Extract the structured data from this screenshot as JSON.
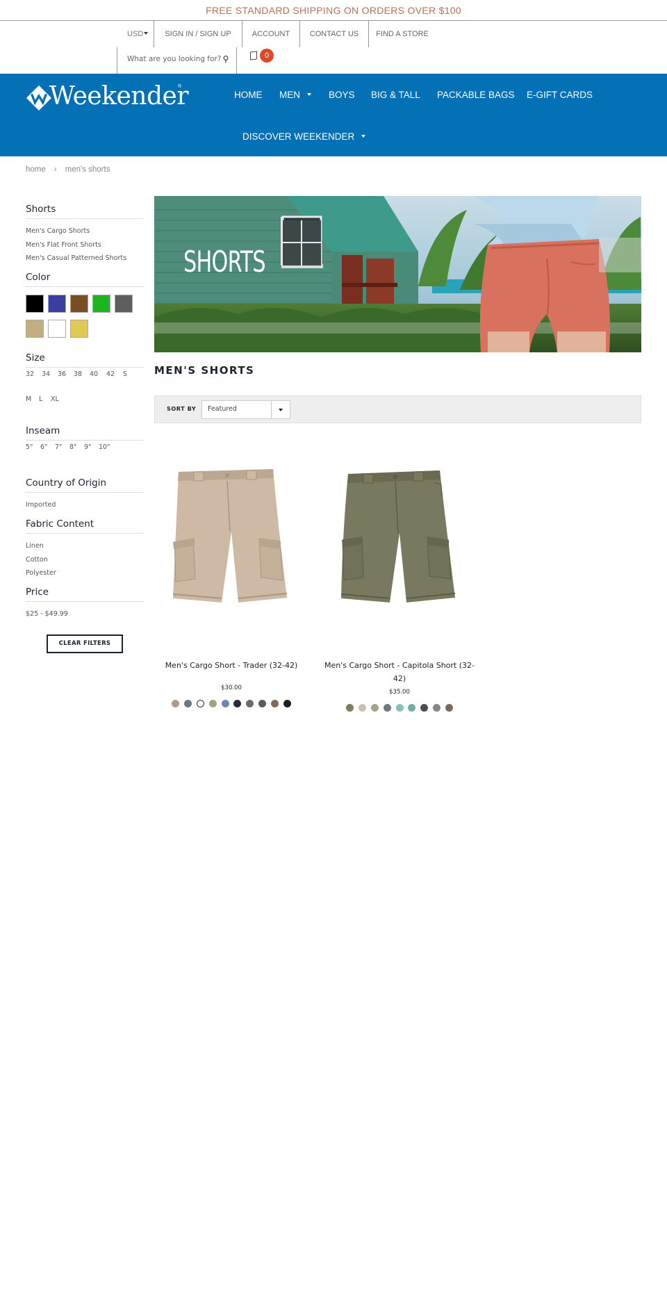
{
  "announcement": "FREE STANDARD SHIPPING ON ORDERS OVER $100",
  "topbar": {
    "currency": "USD",
    "signin": "SIGN IN / SIGN UP",
    "account": "ACCOUNT",
    "contact": "CONTACT US",
    "store": "FIND A STORE"
  },
  "search": {
    "placeholder": "What are you looking for?"
  },
  "cart": {
    "count": "0"
  },
  "brand": {
    "name": "Weekender",
    "reg": "®",
    "nav_color": "#0471b7"
  },
  "nav": {
    "home": "HOME",
    "men": "MEN",
    "boys": "BOYS",
    "bigtall": "BIG & TALL",
    "packable": "PACKABLE BAGS",
    "egift": "E-GIFT CARDS",
    "discover": "DISCOVER WEEKENDER"
  },
  "breadcrumb": {
    "home": "home",
    "sep": "›",
    "current": "men's shorts"
  },
  "filters": {
    "shorts": {
      "title": "Shorts",
      "items": [
        "Men's Cargo Shorts",
        "Men's Flat Front Shorts",
        "Men's Casual Patterned Shorts"
      ]
    },
    "color": {
      "title": "Color",
      "swatches": [
        "#000000",
        "#3a3ea0",
        "#7a4e25",
        "#1fb522",
        "#5e5e5e",
        "#c4ad80",
        "#ffffff",
        "#e0c955"
      ]
    },
    "size": {
      "title": "Size",
      "row1": [
        "32",
        "34",
        "36",
        "38",
        "40",
        "42",
        "S"
      ],
      "row2": [
        "M",
        "L",
        "XL"
      ]
    },
    "inseam": {
      "title": "Inseam",
      "items": [
        "5\"",
        "6\"",
        "7\"",
        "8\"",
        "9\"",
        "10\""
      ]
    },
    "origin": {
      "title": "Country of Origin",
      "items": [
        "Imported"
      ]
    },
    "fabric": {
      "title": "Fabric Content",
      "items": [
        "Linen",
        "Cotton",
        "Polyester"
      ]
    },
    "price": {
      "title": "Price",
      "items": [
        "$25 - $49.99"
      ]
    },
    "clear": "CLEAR FILTERS"
  },
  "banner": {
    "title": "SHORTS"
  },
  "page_title": "MEN'S SHORTS",
  "sort": {
    "label": "SORT BY",
    "value": "Featured"
  },
  "products": [
    {
      "name": "Men's Cargo Short - Trader (32-42)",
      "price": "$30.00",
      "colors": [
        "#b49a86",
        "#6c7785",
        "#ffffff",
        "#a6a184",
        "#7287a6",
        "#272c3d",
        "#6d6c5f",
        "#59595e",
        "#7d6b5c",
        "#1f1f1f"
      ],
      "short_color": "#cdb9a4"
    },
    {
      "name": "Men's Cargo Short - Capitola Short (32-42)",
      "price": "$35.00",
      "colors": [
        "#7c8057",
        "#c9c1b0",
        "#a8a48c",
        "#6f7786",
        "#86c1c0",
        "#6fada3",
        "#4b4c57",
        "#828883",
        "#7b6a5a"
      ],
      "short_color": "#79795f"
    }
  ]
}
